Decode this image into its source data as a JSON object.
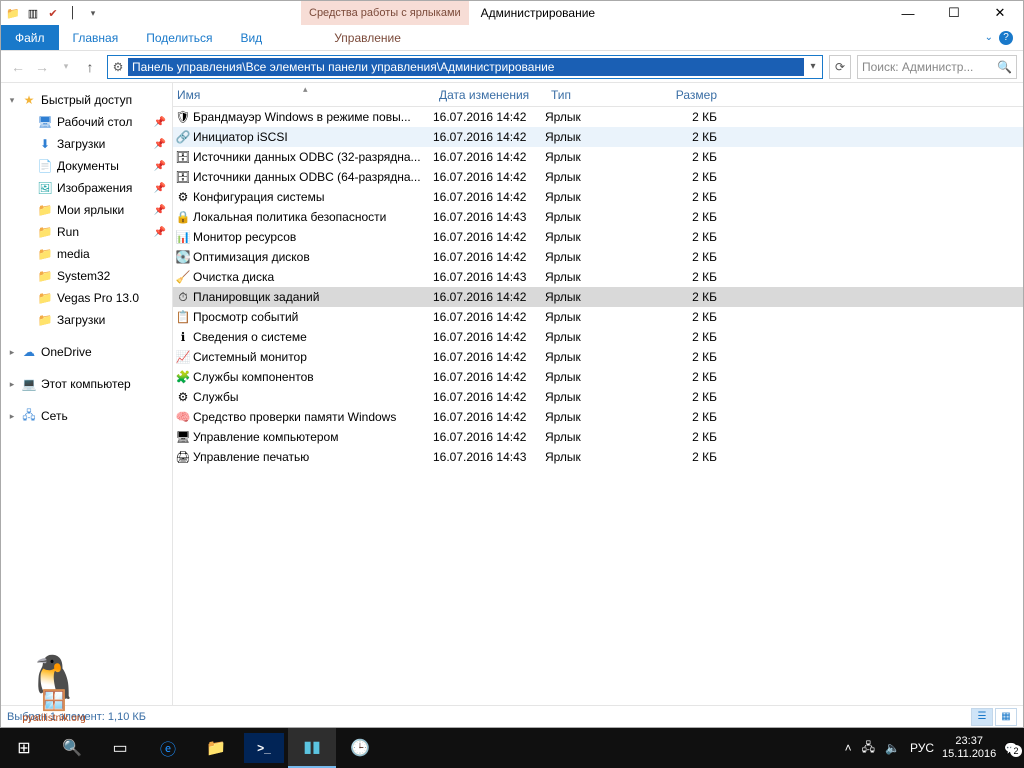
{
  "titlebar": {
    "contextual_tab": "Средства работы с ярлыками",
    "title": "Администрирование"
  },
  "ribbon": {
    "file": "Файл",
    "tabs": [
      "Главная",
      "Поделиться",
      "Вид"
    ],
    "context_tab": "Управление"
  },
  "addressbar": {
    "path": "Панель управления\\Все элементы панели управления\\Администрирование"
  },
  "search": {
    "placeholder": "Поиск: Администр..."
  },
  "nav": {
    "quick": {
      "label": "Быстрый доступ"
    },
    "items": [
      {
        "label": "Рабочий стол",
        "icon": "🖥",
        "cls": "blue-ico",
        "pin": true
      },
      {
        "label": "Загрузки",
        "icon": "⬇",
        "cls": "blue-ico",
        "pin": true
      },
      {
        "label": "Документы",
        "icon": "📄",
        "cls": "",
        "pin": true
      },
      {
        "label": "Изображения",
        "icon": "🖼",
        "cls": "img-ico",
        "pin": true
      },
      {
        "label": "Мои ярлыки",
        "icon": "📁",
        "cls": "folder-ico",
        "pin": true
      },
      {
        "label": "Run",
        "icon": "📁",
        "cls": "folder-ico",
        "pin": true
      },
      {
        "label": "media",
        "icon": "📁",
        "cls": "folder-ico",
        "pin": false
      },
      {
        "label": "System32",
        "icon": "📁",
        "cls": "folder-ico",
        "pin": false
      },
      {
        "label": "Vegas Pro 13.0",
        "icon": "📁",
        "cls": "folder-ico",
        "pin": false
      },
      {
        "label": "Загрузки",
        "icon": "📁",
        "cls": "folder-ico",
        "pin": false
      }
    ],
    "onedrive": "OneDrive",
    "thispc": "Этот компьютер",
    "network": "Сеть"
  },
  "columns": {
    "name": "Имя",
    "date": "Дата изменения",
    "type": "Тип",
    "size": "Размер"
  },
  "rows": [
    {
      "icon": "🛡",
      "name": "Брандмауэр Windows в режиме повы...",
      "date": "16.07.2016 14:42",
      "type": "Ярлык",
      "size": "2 КБ",
      "state": ""
    },
    {
      "icon": "🔗",
      "name": "Инициатор iSCSI",
      "date": "16.07.2016 14:42",
      "type": "Ярлык",
      "size": "2 КБ",
      "state": "hl"
    },
    {
      "icon": "🗄",
      "name": "Источники данных ODBC (32-разрядна...",
      "date": "16.07.2016 14:42",
      "type": "Ярлык",
      "size": "2 КБ",
      "state": ""
    },
    {
      "icon": "🗄",
      "name": "Источники данных ODBC (64-разрядна...",
      "date": "16.07.2016 14:42",
      "type": "Ярлык",
      "size": "2 КБ",
      "state": ""
    },
    {
      "icon": "⚙",
      "name": "Конфигурация системы",
      "date": "16.07.2016 14:42",
      "type": "Ярлык",
      "size": "2 КБ",
      "state": ""
    },
    {
      "icon": "🔒",
      "name": "Локальная политика безопасности",
      "date": "16.07.2016 14:43",
      "type": "Ярлык",
      "size": "2 КБ",
      "state": ""
    },
    {
      "icon": "📊",
      "name": "Монитор ресурсов",
      "date": "16.07.2016 14:42",
      "type": "Ярлык",
      "size": "2 КБ",
      "state": ""
    },
    {
      "icon": "💽",
      "name": "Оптимизация дисков",
      "date": "16.07.2016 14:42",
      "type": "Ярлык",
      "size": "2 КБ",
      "state": ""
    },
    {
      "icon": "🧹",
      "name": "Очистка диска",
      "date": "16.07.2016 14:43",
      "type": "Ярлык",
      "size": "2 КБ",
      "state": ""
    },
    {
      "icon": "⏱",
      "name": "Планировщик заданий",
      "date": "16.07.2016 14:42",
      "type": "Ярлык",
      "size": "2 КБ",
      "state": "sel"
    },
    {
      "icon": "📋",
      "name": "Просмотр событий",
      "date": "16.07.2016 14:42",
      "type": "Ярлык",
      "size": "2 КБ",
      "state": ""
    },
    {
      "icon": "ℹ",
      "name": "Сведения о системе",
      "date": "16.07.2016 14:42",
      "type": "Ярлык",
      "size": "2 КБ",
      "state": ""
    },
    {
      "icon": "📈",
      "name": "Системный монитор",
      "date": "16.07.2016 14:42",
      "type": "Ярлык",
      "size": "2 КБ",
      "state": ""
    },
    {
      "icon": "🧩",
      "name": "Службы компонентов",
      "date": "16.07.2016 14:42",
      "type": "Ярлык",
      "size": "2 КБ",
      "state": ""
    },
    {
      "icon": "⚙",
      "name": "Службы",
      "date": "16.07.2016 14:42",
      "type": "Ярлык",
      "size": "2 КБ",
      "state": ""
    },
    {
      "icon": "🧠",
      "name": "Средство проверки памяти Windows",
      "date": "16.07.2016 14:42",
      "type": "Ярлык",
      "size": "2 КБ",
      "state": ""
    },
    {
      "icon": "🖥",
      "name": "Управление компьютером",
      "date": "16.07.2016 14:42",
      "type": "Ярлык",
      "size": "2 КБ",
      "state": ""
    },
    {
      "icon": "🖨",
      "name": "Управление печатью",
      "date": "16.07.2016 14:43",
      "type": "Ярлык",
      "size": "2 КБ",
      "state": ""
    }
  ],
  "status": {
    "text": "Выбран 1 элемент: 1,10 КБ"
  },
  "watermark": {
    "site": "pyatilistnik.org"
  },
  "taskbar": {
    "lang": "РУС",
    "time": "23:37",
    "date": "15.11.2016",
    "notif": "2"
  }
}
